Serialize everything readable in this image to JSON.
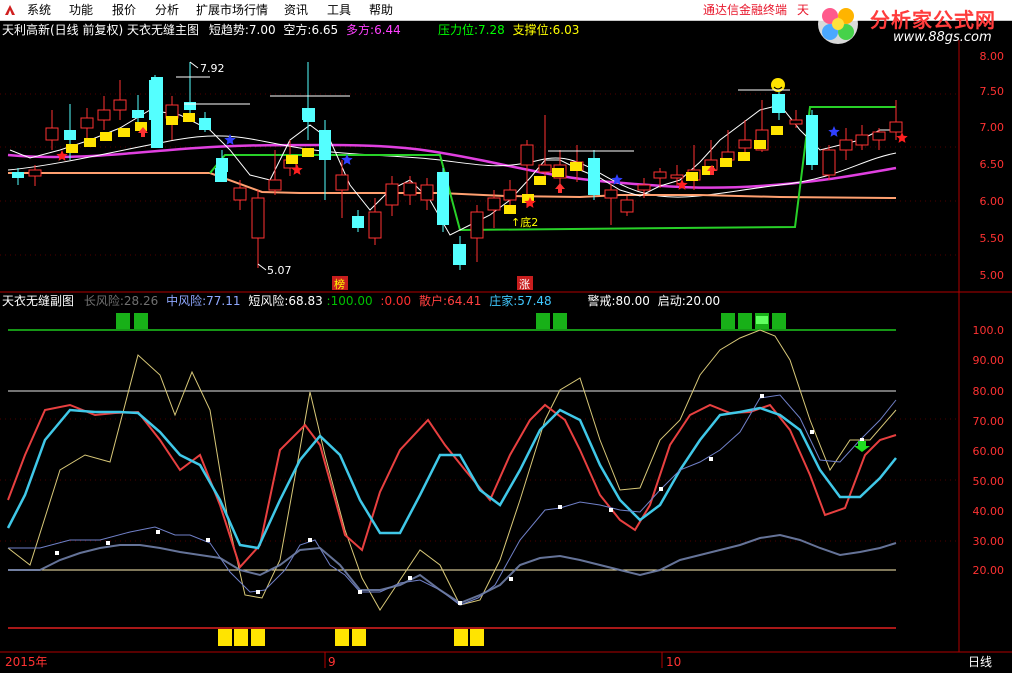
{
  "menu": {
    "items": [
      "系统",
      "功能",
      "报价",
      "分析",
      "扩展市场行情",
      "资讯",
      "工具",
      "帮助"
    ]
  },
  "promo": {
    "text": "通达信金融终端",
    "extra": "天",
    "brand": "分析家公式网",
    "site": "www.88gs.com"
  },
  "main_chart": {
    "title": "天利高新(日线 前复权) 天衣无缝主图",
    "indicators": [
      {
        "label": "短趋势:",
        "value": "7.00",
        "color": "#ffffff"
      },
      {
        "label": "空方:",
        "value": "6.65",
        "color": "#ffffff"
      },
      {
        "label": "多方:",
        "value": "6.44",
        "color": "#ff40ff"
      },
      {
        "label": "压力位:",
        "value": "7.28",
        "color": "#00ff00"
      },
      {
        "label": "支撑位:",
        "value": "6.03",
        "color": "#ffff00"
      }
    ],
    "price_axis": [
      "8.00",
      "7.50",
      "7.00",
      "6.50",
      "6.00",
      "5.50",
      "5.00"
    ],
    "high_label": "7.92",
    "low_label": "5.07",
    "bottom_label": "↑底2",
    "marks": [
      "榜",
      "涨"
    ]
  },
  "sub_chart": {
    "title": "天衣无缝副图",
    "indicators": [
      {
        "label": "长风险:",
        "value": "28.26",
        "color": "#707070"
      },
      {
        "label": "中风险:",
        "value": "77.11",
        "color": "#8fa8ff"
      },
      {
        "label": "短风险:",
        "value": "68.83",
        "color": "#ffffff"
      },
      {
        "label": ":",
        "value": "100.00",
        "color": "#00c000"
      },
      {
        "label": ":",
        "value": "0.00",
        "color": "#ff3030"
      },
      {
        "label": "散户:",
        "value": "64.41",
        "color": "#ff4040"
      },
      {
        "label": "庄家:",
        "value": "57.48",
        "color": "#40c8ff"
      },
      {
        "label": "警戒:",
        "value": "80.00",
        "color": "#ffffff"
      },
      {
        "label": "启动:",
        "value": "20.00",
        "color": "#ffffff"
      }
    ],
    "axis": [
      "100.0",
      "90.00",
      "80.00",
      "70.00",
      "60.00",
      "50.00",
      "40.00",
      "30.00",
      "20.00"
    ]
  },
  "date_axis": {
    "labels": [
      "2015年",
      "9",
      "10"
    ],
    "period": "日线"
  },
  "colors": {
    "background": "#000000",
    "frame": "#b00000",
    "up": "#ff3232",
    "down": "#54ffff"
  }
}
